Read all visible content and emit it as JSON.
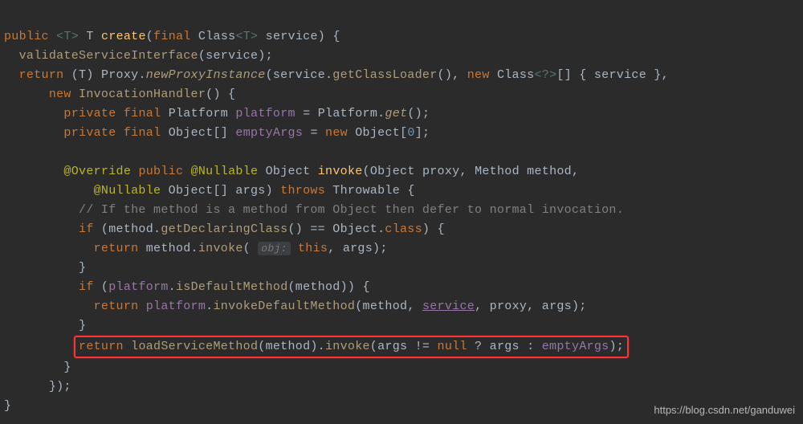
{
  "code": {
    "l1": {
      "public": "public",
      "generic": "<T>",
      "t": "T",
      "create": "create",
      "finalKw": "final",
      "classType": "Class",
      "classGen": "<T>",
      "paramName": "service",
      "brace": ") {"
    },
    "l2": {
      "call": "validateServiceInterface",
      "arg": "service",
      "semi": ");"
    },
    "l3": {
      "ret": "return",
      "cast": "(T) Proxy.",
      "newProxy": "newProxyInstance",
      "svc": "(service.",
      "getCL": "getClassLoader",
      "after1": "(), ",
      "newKw": "new",
      "classT": " Class",
      "gen": "<?>",
      "arr": "[] { service },"
    },
    "l4": {
      "newKw": "new",
      "invH": "InvocationHandler",
      "after": "() {"
    },
    "l5": {
      "priv": "private",
      "fin": "final",
      "plat": "Platform",
      "fld": "platform",
      "eq": " = Platform.",
      "get": "get",
      "end": "();"
    },
    "l6": {
      "priv": "private",
      "fin": "final",
      "obj": "Object[]",
      "fld": "emptyArgs",
      "eq": " = ",
      "newKw": "new",
      "objT": " Object[",
      "zero": "0",
      "end": "];"
    },
    "l7": {
      "override": "@Override",
      "pub": "public",
      "nullable": "@Nullable",
      "obj": "Object",
      "invoke": "invoke",
      "p1": "(Object proxy, Method method,"
    },
    "l8": {
      "nullable": "@Nullable",
      "objArr": "Object[] args) ",
      "throws": "throws",
      "throwable": " Throwable {"
    },
    "l9": {
      "comment": "// If the method is a method from Object then defer to normal invocation."
    },
    "l10": {
      "ifKw": "if",
      "open": " (method.",
      "getDC": "getDeclaringClass",
      "mid": "() == Object.",
      "classKw": "class",
      "end": ") {"
    },
    "l11": {
      "ret": "return",
      "mid": " method.",
      "invoke": "invoke",
      "open": "( ",
      "hint": "obj:",
      "thisKw": "this",
      "end": ", args);"
    },
    "l12": {
      "brace": "}"
    },
    "l13": {
      "ifKw": "if",
      "open": " (",
      "plat": "platform",
      "dot": ".",
      "isDM": "isDefaultMethod",
      "end": "(method)) {"
    },
    "l14": {
      "ret": "return",
      "sp": " ",
      "plat": "platform",
      "dot": ".",
      "invDM": "invokeDefaultMethod",
      "open": "(method, ",
      "svc": "service",
      "end": ", proxy, args);"
    },
    "l15": {
      "brace": "}"
    },
    "l16": {
      "ret": "return",
      "sp": " ",
      "lsm": "loadServiceMethod",
      "mid": "(method).",
      "invoke": "invoke",
      "open": "(args != ",
      "nullKw": "null",
      "tern": " ? args : ",
      "empty": "emptyArgs",
      "end": ");"
    },
    "l17": {
      "brace": "}"
    },
    "l18": {
      "end": "});"
    },
    "l19": {
      "brace": "}"
    }
  },
  "indent": {
    "i0": "",
    "i1": "  ",
    "i2": "      ",
    "i3": "        ",
    "i4": "            ",
    "i5": "          ",
    "i6": "              "
  },
  "watermark": "https://blog.csdn.net/ganduwei"
}
